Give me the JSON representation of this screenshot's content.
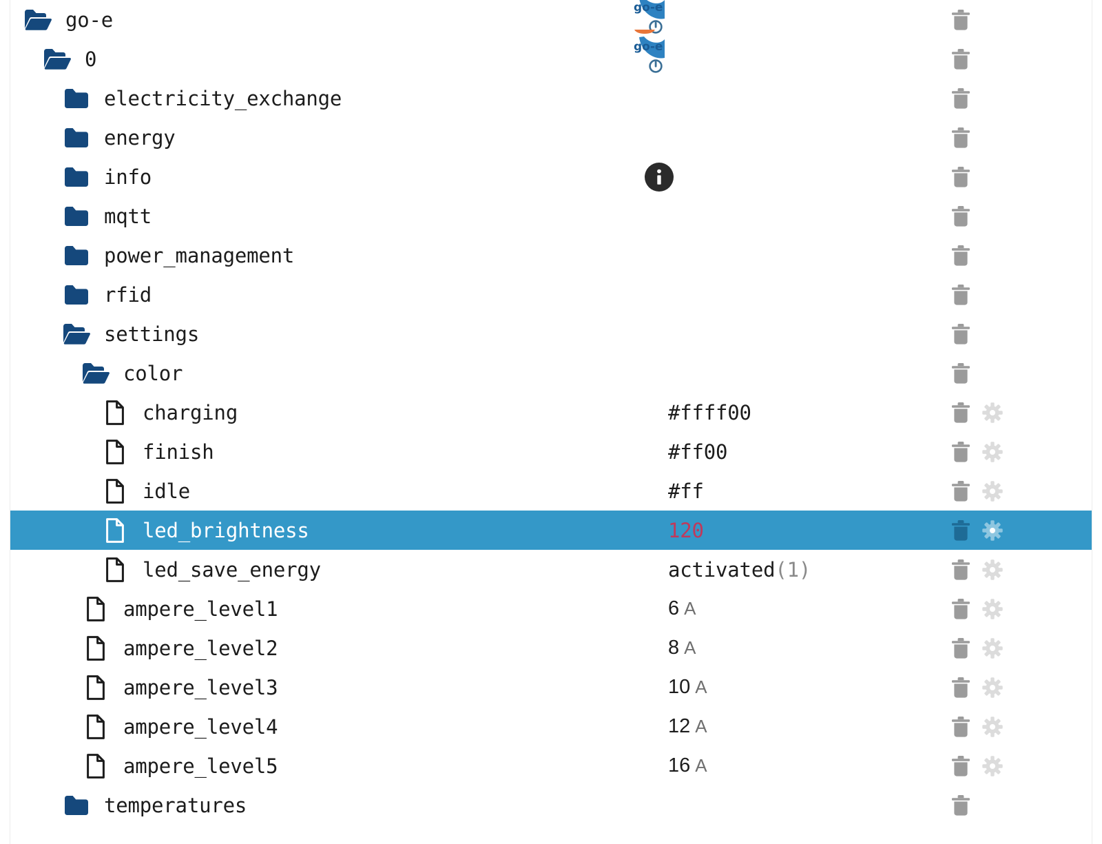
{
  "app": {
    "title": "go-e API tree browser",
    "selected_row": "led_brightness"
  },
  "colors": {
    "folder_blue": "#15487c",
    "selection_blue": "#3498c8",
    "selection_trash": "#1e6b96",
    "trash_gray": "#9b9b9b",
    "gear_gray": "#dcdcdc",
    "value_red": "#c0395b",
    "info_dark": "#2b2b2b",
    "logo_blue": "#1c77bc",
    "logo_orange": "#e8763a",
    "rule_gray": "#ececec"
  },
  "icons": {
    "folder_open": "folder-open-icon",
    "folder_closed": "folder-closed-icon",
    "file": "file-icon",
    "trash": "trash-icon",
    "gear": "gear-icon",
    "info": "info-icon",
    "logo": "go-e-logo-icon",
    "power": "power-icon"
  },
  "tree": {
    "rows": [
      {
        "label": "go-e",
        "depth": 0,
        "icon": "folder-open-icon",
        "value": null,
        "unit": null,
        "badge": "logo-power",
        "trash": true,
        "gear": false,
        "selected": false
      },
      {
        "label": "0",
        "depth": 1,
        "icon": "folder-open-icon",
        "value": null,
        "unit": null,
        "badge": "logo-power",
        "trash": true,
        "gear": false,
        "selected": false
      },
      {
        "label": "electricity_exchange",
        "depth": 2,
        "icon": "folder-closed-icon",
        "value": null,
        "unit": null,
        "badge": null,
        "trash": true,
        "gear": false,
        "selected": false
      },
      {
        "label": "energy",
        "depth": 2,
        "icon": "folder-closed-icon",
        "value": null,
        "unit": null,
        "badge": null,
        "trash": true,
        "gear": false,
        "selected": false
      },
      {
        "label": "info",
        "depth": 2,
        "icon": "folder-closed-icon",
        "value": null,
        "unit": null,
        "badge": "info",
        "trash": true,
        "gear": false,
        "selected": false
      },
      {
        "label": "mqtt",
        "depth": 2,
        "icon": "folder-closed-icon",
        "value": null,
        "unit": null,
        "badge": null,
        "trash": true,
        "gear": false,
        "selected": false
      },
      {
        "label": "power_management",
        "depth": 2,
        "icon": "folder-closed-icon",
        "value": null,
        "unit": null,
        "badge": null,
        "trash": true,
        "gear": false,
        "selected": false
      },
      {
        "label": "rfid",
        "depth": 2,
        "icon": "folder-closed-icon",
        "value": null,
        "unit": null,
        "badge": null,
        "trash": true,
        "gear": false,
        "selected": false
      },
      {
        "label": "settings",
        "depth": 2,
        "icon": "folder-open-icon",
        "value": null,
        "unit": null,
        "badge": null,
        "trash": true,
        "gear": false,
        "selected": false
      },
      {
        "label": "color",
        "depth": 3,
        "icon": "folder-open-icon",
        "value": null,
        "unit": null,
        "badge": null,
        "trash": true,
        "gear": false,
        "selected": false
      },
      {
        "label": "charging",
        "depth": 4,
        "icon": "file-icon",
        "value": "#ffff00",
        "unit": null,
        "badge": null,
        "trash": true,
        "gear": true,
        "selected": false
      },
      {
        "label": "finish",
        "depth": 4,
        "icon": "file-icon",
        "value": "#ff00",
        "unit": null,
        "badge": null,
        "trash": true,
        "gear": true,
        "selected": false
      },
      {
        "label": "idle",
        "depth": 4,
        "icon": "file-icon",
        "value": "#ff",
        "unit": null,
        "badge": null,
        "trash": true,
        "gear": true,
        "selected": false
      },
      {
        "label": "led_brightness",
        "depth": 4,
        "icon": "file-icon",
        "value": "120",
        "unit": null,
        "badge": null,
        "trash": true,
        "gear": true,
        "selected": true
      },
      {
        "label": "led_save_energy",
        "depth": 4,
        "icon": "file-icon",
        "value": "activated(1)",
        "unit": null,
        "badge": null,
        "trash": true,
        "gear": true,
        "selected": false
      },
      {
        "label": "ampere_level1",
        "depth": 3,
        "icon": "file-icon",
        "value": "6",
        "unit": "A",
        "badge": null,
        "trash": true,
        "gear": true,
        "selected": false
      },
      {
        "label": "ampere_level2",
        "depth": 3,
        "icon": "file-icon",
        "value": "8",
        "unit": "A",
        "badge": null,
        "trash": true,
        "gear": true,
        "selected": false
      },
      {
        "label": "ampere_level3",
        "depth": 3,
        "icon": "file-icon",
        "value": "10",
        "unit": "A",
        "badge": null,
        "trash": true,
        "gear": true,
        "selected": false
      },
      {
        "label": "ampere_level4",
        "depth": 3,
        "icon": "file-icon",
        "value": "12",
        "unit": "A",
        "badge": null,
        "trash": true,
        "gear": true,
        "selected": false
      },
      {
        "label": "ampere_level5",
        "depth": 3,
        "icon": "file-icon",
        "value": "16",
        "unit": "A",
        "badge": null,
        "trash": true,
        "gear": true,
        "selected": false
      },
      {
        "label": "temperatures",
        "depth": 2,
        "icon": "folder-closed-icon",
        "value": null,
        "unit": null,
        "badge": null,
        "trash": true,
        "gear": false,
        "selected": false
      }
    ]
  }
}
